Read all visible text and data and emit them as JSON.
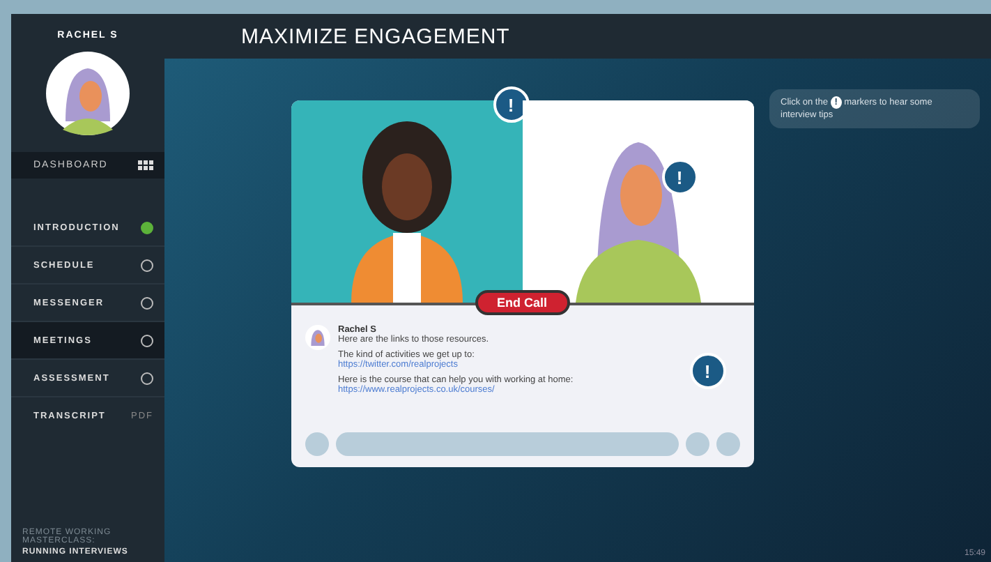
{
  "user": {
    "name": "RACHEL S"
  },
  "dashboard": {
    "label": "DASHBOARD"
  },
  "nav": [
    {
      "label": "INTRODUCTION",
      "kind": "module",
      "complete": true,
      "selected": false
    },
    {
      "label": "SCHEDULE",
      "kind": "module",
      "complete": false,
      "selected": false
    },
    {
      "label": "MESSENGER",
      "kind": "module",
      "complete": false,
      "selected": false
    },
    {
      "label": "MEETINGS",
      "kind": "module",
      "complete": false,
      "selected": true
    },
    {
      "label": "ASSESSMENT",
      "kind": "module",
      "complete": false,
      "selected": false
    },
    {
      "label": "TRANSCRIPT",
      "kind": "download",
      "badge": "PDF"
    }
  ],
  "course": {
    "title": "REMOTE WORKING MASTERCLASS:",
    "subtitle": "RUNNING INTERVIEWS"
  },
  "header": {
    "title": "MAXIMIZE ENGAGEMENT"
  },
  "tip": {
    "before": "Click on the",
    "marker": "!",
    "after": "markers to hear some interview tips"
  },
  "call": {
    "end_button": "End Call",
    "markers": [
      "!",
      "!",
      "!"
    ],
    "message": {
      "sender": "Rachel S",
      "lines": [
        {
          "kind": "text",
          "text": "Here are the links to those resources."
        },
        {
          "kind": "text",
          "text": "The kind of activities we get up to:"
        },
        {
          "kind": "link",
          "text": "https://twitter.com/realprojects"
        },
        {
          "kind": "text",
          "text": "Here is the course that can help you with working at home:"
        },
        {
          "kind": "link",
          "text": "https://www.realprojects.co.uk/courses/"
        }
      ]
    }
  },
  "page_number": "15:49"
}
